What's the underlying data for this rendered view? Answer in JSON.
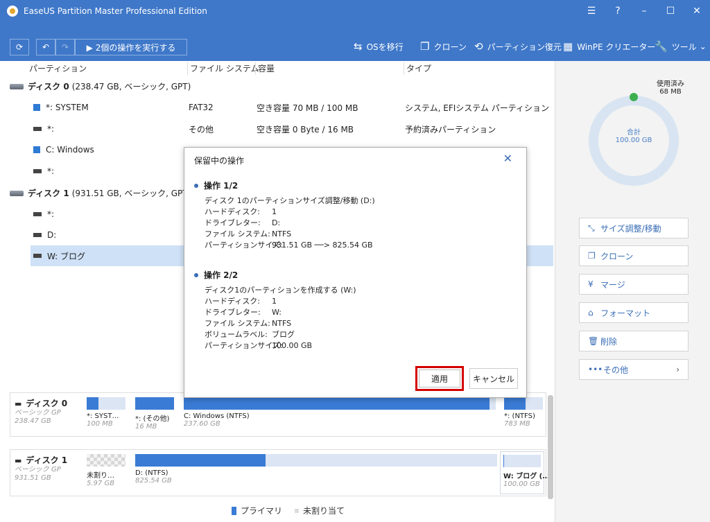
{
  "window": {
    "title": "EaseUS Partition Master Professional Edition",
    "controls": [
      "☰",
      "?",
      "–",
      "☐",
      "✕"
    ]
  },
  "toolbar": {
    "execute_label": "▶ 2個の操作を実行する",
    "os_migrate": "OSを移行",
    "clone": "クローン",
    "recover": "パーティション復元",
    "winpe": "WinPE クリエーター",
    "tools": "ツール"
  },
  "table": {
    "headers": [
      "パーティション",
      "ファイル システム",
      "容量",
      "タイプ"
    ],
    "disk0": {
      "name": "ディスク 0",
      "info": "(238.47 GB, ベーシック, GPT)"
    },
    "disk1": {
      "name": "ディスク 1",
      "info": "(931.51 GB, ベーシック, GPT)"
    },
    "rows": [
      {
        "name": "*: SYSTEM",
        "fs": "FAT32",
        "cap": "空き容量 70 MB / 100 MB",
        "type": "システム, EFIシステム パーティション"
      },
      {
        "name": "*:",
        "fs": "その他",
        "cap": "空き容量 0 Byte / 16 MB",
        "type": "予約済みパーティション"
      },
      {
        "name": "C: Windows",
        "fs": "",
        "cap": "",
        "type": ""
      },
      {
        "name": "*:",
        "fs": "",
        "cap": "",
        "type": ""
      },
      {
        "name": "*:",
        "fs": "",
        "cap": "",
        "type": ""
      },
      {
        "name": "D:",
        "fs": "",
        "cap": "",
        "type": ""
      },
      {
        "name": "W: ブログ",
        "fs": "",
        "cap": "",
        "type": ""
      }
    ]
  },
  "diskmap": {
    "disk0": {
      "name": "ディスク 0",
      "type": "ベーシック GP",
      "size": "238.47 GB",
      "segments": [
        {
          "name": "*: SYST…",
          "size": "100 MB",
          "used": 0.3
        },
        {
          "name": "*: (その他)",
          "size": "16 MB",
          "used": 1.0
        },
        {
          "name": "C: Windows (NTFS)",
          "size": "237.60 GB",
          "used": 0.98
        },
        {
          "name": "*: (NTFS)",
          "size": "783 MB",
          "used": 0.55
        }
      ]
    },
    "disk1": {
      "name": "ディスク 1",
      "type": "ベーシック GP",
      "size": "931.51 GB",
      "segments": [
        {
          "name": "未割り…",
          "size": "5.97 GB",
          "used": 0
        },
        {
          "name": "D: (NTFS)",
          "size": "825.54 GB",
          "used": 0.36
        },
        {
          "name": "W: ブログ (…",
          "size": "100.00 GB",
          "used": 0.02
        }
      ]
    }
  },
  "legend": {
    "primary": "プライマリ",
    "unallocated": "未割り当て"
  },
  "right_panel": {
    "used_label": "使用済み",
    "used_value": "68 MB",
    "total_label": "合計",
    "total_value": "100.00 GB",
    "actions": [
      "サイズ調整/移動",
      "クローン",
      "マージ",
      "フォーマット",
      "削除",
      "その他"
    ]
  },
  "dialog": {
    "title": "保留中の操作",
    "op1": {
      "heading": "操作 1/2",
      "desc": "ディスク 1のパーティションサイズ調整/移動 (D:)",
      "fields": [
        {
          "k": "ハードディスク:",
          "v": "1"
        },
        {
          "k": "ドライブレター:",
          "v": "D:"
        },
        {
          "k": "ファイル システム:",
          "v": "NTFS"
        },
        {
          "k": "パーティションサイズ:",
          "v": "931.51 GB ──> 825.54 GB"
        }
      ]
    },
    "op2": {
      "heading": "操作 2/2",
      "desc": "ディスク1のパーティションを作成する (W:)",
      "fields": [
        {
          "k": "ハードディスク:",
          "v": "1"
        },
        {
          "k": "ドライブレター:",
          "v": "W:"
        },
        {
          "k": "ファイル システム:",
          "v": "NTFS"
        },
        {
          "k": "ボリュームラベル:",
          "v": "ブログ"
        },
        {
          "k": "パーティションサイズ:",
          "v": "100.00 GB"
        }
      ]
    },
    "apply": "適用",
    "cancel": "キャンセル"
  },
  "colors": {
    "brand": "#3f78c9",
    "accent": "#3a7bd5",
    "highlight": "#d40000",
    "used_dot": "#3cb04e"
  }
}
